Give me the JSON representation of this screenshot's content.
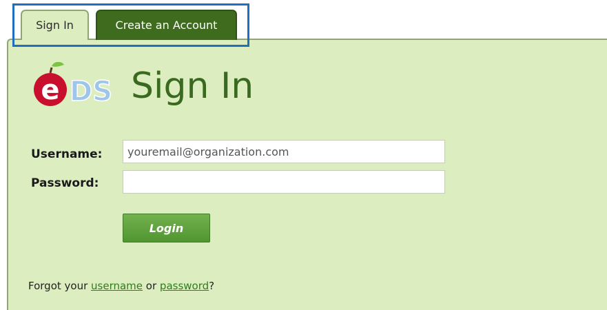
{
  "tabs": {
    "sign_in_label": "Sign In",
    "create_account_label": "Create an Account"
  },
  "logo": {
    "text": "eDS"
  },
  "header": {
    "title": "Sign In"
  },
  "form": {
    "username_label": "Username:",
    "username_value": "youremail@organization.com",
    "password_label": "Password:",
    "password_value": "",
    "login_label": "Login"
  },
  "forgot": {
    "prefix": "Forgot your ",
    "username_link": "username",
    "middle": " or ",
    "password_link": "password",
    "suffix": "?"
  },
  "colors": {
    "panel_bg": "#dcedc0",
    "active_tab_bg": "#3f6b1f",
    "accent_green": "#3a6a1f",
    "button_green": "#5ea13a",
    "link_green": "#2e7d1b",
    "highlight_blue": "#1f6fc0",
    "logo_red": "#c8102e",
    "logo_blue": "#9fc6e8"
  }
}
